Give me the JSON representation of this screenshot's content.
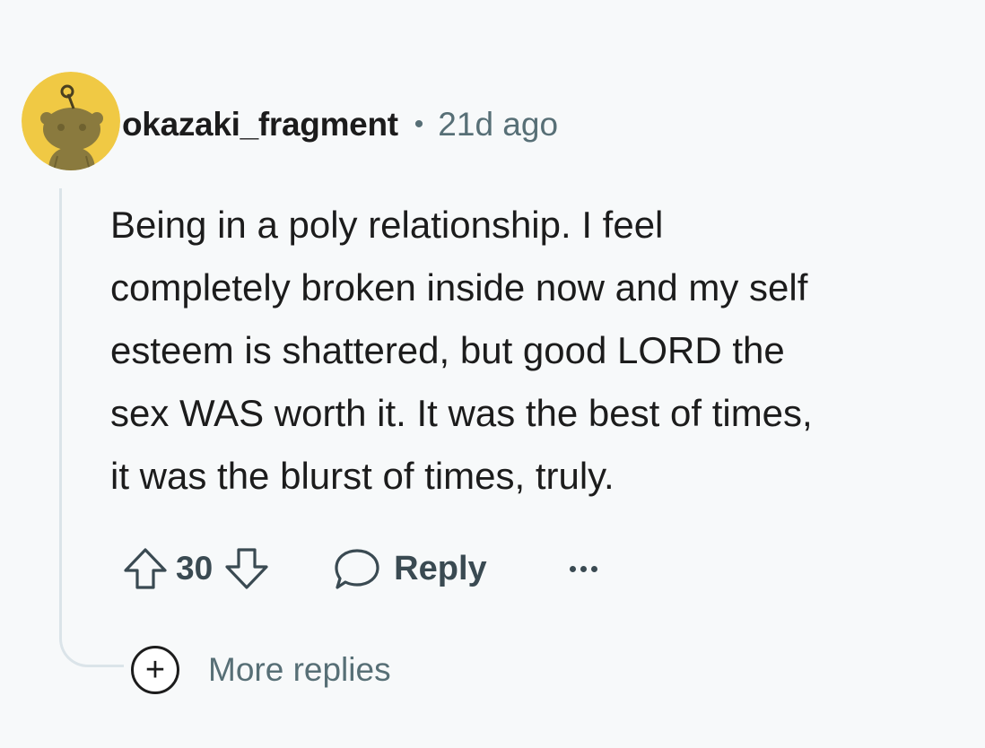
{
  "comment": {
    "author": "okazaki_fragment",
    "separator": "•",
    "time_ago": "21d ago",
    "body_lines": [
      "Being in a poly relationship. I feel",
      "completely broken inside now and my self",
      "esteem is shattered, but good LORD the",
      "sex WAS worth it. It was the best of times,",
      "it was the blurst of times, truly."
    ],
    "score": "30",
    "reply_label": "Reply",
    "more_replies_label": "More replies",
    "more_replies_icon": "+"
  },
  "colors": {
    "background": "#f7f9fa",
    "avatar_background": "#f0c944",
    "text": "#1c1c1c",
    "muted": "#576f76",
    "thread_line": "#dbe4e9"
  },
  "icons": {
    "avatar": "reddit-snoo-avatar",
    "upvote": "upvote-arrow-icon",
    "downvote": "downvote-arrow-icon",
    "reply": "speech-bubble-icon",
    "overflow": "ellipsis-icon",
    "expand": "plus-circle-icon"
  }
}
